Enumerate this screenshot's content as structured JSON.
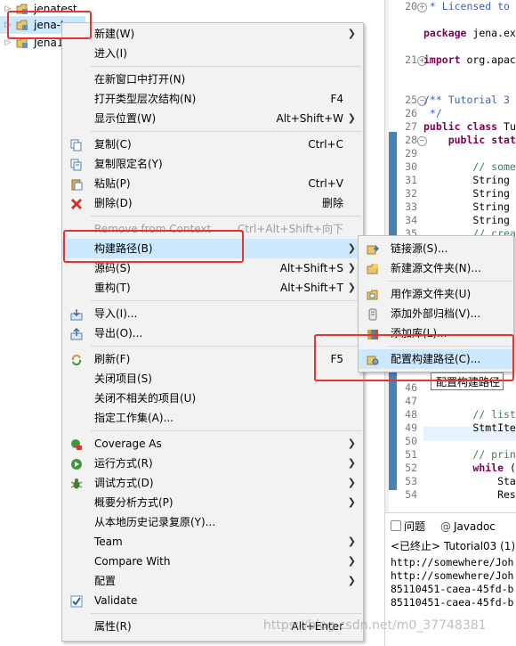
{
  "tree": {
    "items": [
      {
        "label": "jenatest",
        "expanded": false
      },
      {
        "label": "jena-t",
        "expanded": false,
        "selected": true
      },
      {
        "label": "Jena1",
        "expanded": false
      }
    ]
  },
  "context_menu": {
    "items": [
      {
        "label": "新建(W)",
        "submenu": true,
        "icon": "none"
      },
      {
        "label": "进入(I)",
        "icon": "none"
      },
      {
        "separator": true
      },
      {
        "label": "在新窗口中打开(N)",
        "icon": "none"
      },
      {
        "label": "打开类型层次结构(N)",
        "shortcut": "F4",
        "icon": "none"
      },
      {
        "label": "显示位置(W)",
        "shortcut": "Alt+Shift+W",
        "submenu": true,
        "icon": "none"
      },
      {
        "separator": true
      },
      {
        "label": "复制(C)",
        "shortcut": "Ctrl+C",
        "icon": "copy-icon"
      },
      {
        "label": "复制限定名(Y)",
        "icon": "copy-qualified-icon"
      },
      {
        "label": "粘贴(P)",
        "shortcut": "Ctrl+V",
        "icon": "paste-icon"
      },
      {
        "label": "删除(D)",
        "shortcut": "删除",
        "icon": "delete-icon"
      },
      {
        "separator": true
      },
      {
        "label": "Remove from Context",
        "shortcut": "Ctrl+Alt+Shift+向下",
        "disabled": true,
        "icon": "none"
      },
      {
        "label": "构建路径(B)",
        "submenu": true,
        "highlighted": true,
        "icon": "none"
      },
      {
        "label": "源码(S)",
        "shortcut": "Alt+Shift+S",
        "submenu": true,
        "icon": "none"
      },
      {
        "label": "重构(T)",
        "shortcut": "Alt+Shift+T",
        "submenu": true,
        "icon": "none"
      },
      {
        "separator": true
      },
      {
        "label": "导入(I)...",
        "icon": "import-icon"
      },
      {
        "label": "导出(O)...",
        "icon": "export-icon"
      },
      {
        "separator": true
      },
      {
        "label": "刷新(F)",
        "shortcut": "F5",
        "icon": "refresh-icon"
      },
      {
        "label": "关闭项目(S)",
        "icon": "none"
      },
      {
        "label": "关闭不相关的项目(U)",
        "icon": "none"
      },
      {
        "label": "指定工作集(A)...",
        "icon": "none"
      },
      {
        "separator": true
      },
      {
        "label": "Coverage As",
        "submenu": true,
        "icon": "coverage-icon"
      },
      {
        "label": "运行方式(R)",
        "submenu": true,
        "icon": "run-icon"
      },
      {
        "label": "调试方式(D)",
        "submenu": true,
        "icon": "debug-icon"
      },
      {
        "label": "概要分析方式(P)",
        "submenu": true,
        "icon": "none"
      },
      {
        "label": "从本地历史记录复原(Y)...",
        "icon": "none"
      },
      {
        "label": "Team",
        "submenu": true,
        "icon": "none"
      },
      {
        "label": "Compare With",
        "submenu": true,
        "icon": "none"
      },
      {
        "label": "配置",
        "submenu": true,
        "icon": "none"
      },
      {
        "label": "Validate",
        "icon": "check-icon"
      },
      {
        "separator": true
      },
      {
        "label": "属性(R)",
        "shortcut": "Alt+Enter",
        "icon": "none"
      }
    ]
  },
  "submenu": {
    "items": [
      {
        "label": "链接源(S)...",
        "icon": "link-source-icon"
      },
      {
        "label": "新建源文件夹(N)...",
        "icon": "new-source-folder-icon"
      },
      {
        "separator": true
      },
      {
        "label": "用作源文件夹(U)",
        "icon": "use-source-folder-icon"
      },
      {
        "label": "添加外部归档(V)...",
        "icon": "add-archive-icon"
      },
      {
        "label": "添加库(L)...",
        "icon": "add-library-icon"
      },
      {
        "separator": true
      },
      {
        "label": "配置构建路径(C)...",
        "icon": "configure-build-path-icon",
        "highlighted": true
      }
    ]
  },
  "tooltip": "配置构建路径",
  "editor": {
    "lines": [
      {
        "n": "20",
        "fold": "plus",
        "html": "<span class='jd'> * Licensed to</span>"
      },
      {
        "n": "",
        "html": ""
      },
      {
        "n": "",
        "html": "<span class='kw'>package</span> jena.ex"
      },
      {
        "n": "",
        "html": ""
      },
      {
        "n": "21",
        "fold": "plus",
        "html": "<span class='kw'>import</span> org.apac"
      },
      {
        "n": "",
        "html": ""
      },
      {
        "n": "",
        "html": ""
      },
      {
        "n": "25",
        "fold": "minus",
        "html": "<span class='jd'>/** Tutorial 3</span>"
      },
      {
        "n": "26",
        "html": "<span class='jd'> */</span>"
      },
      {
        "n": "27",
        "html": "<span class='kw'>public</span> <span class='kw'>class</span> Tu"
      },
      {
        "n": "28",
        "fold": "minus",
        "html": "    <span class='kw'>public</span> <span class='kw'>stat</span>"
      },
      {
        "n": "29",
        "html": ""
      },
      {
        "n": "30",
        "html": "        <span class='cm'>// some</span>"
      },
      {
        "n": "31",
        "html": "        String"
      },
      {
        "n": "32",
        "html": "        String"
      },
      {
        "n": "33",
        "html": "        String"
      },
      {
        "n": "34",
        "html": "        String"
      },
      {
        "n": "35",
        "html": "        <span class='cm'>// crea</span>"
      },
      {
        "n": "",
        "html": ""
      },
      {
        "n": "",
        "html": ""
      },
      {
        "n": "",
        "html": ""
      },
      {
        "n": "",
        "html": ""
      },
      {
        "n": "",
        "html": ""
      },
      {
        "n": "",
        "html": ""
      },
      {
        "n": "",
        "html": ""
      },
      {
        "n": "",
        "html": ""
      },
      {
        "n": "",
        "html": ""
      },
      {
        "n": "",
        "html": ""
      },
      {
        "n": "46",
        "html": ""
      },
      {
        "n": "47",
        "html": ""
      },
      {
        "n": "48",
        "html": "        <span class='cm'>// list</span>"
      },
      {
        "n": "49",
        "html": "        StmtIte"
      },
      {
        "n": "50",
        "html": ""
      },
      {
        "n": "51",
        "html": "        <span class='cm'>// prin</span>"
      },
      {
        "n": "52",
        "html": "        <span class='kw'>while</span> ("
      },
      {
        "n": "53",
        "html": "            Sta"
      },
      {
        "n": "54",
        "html": "            Res"
      }
    ]
  },
  "console": {
    "tab_problems": "问题",
    "tab_javadoc": "Javadoc",
    "status": "<已终止> Tutorial03 (1)",
    "lines": [
      "http://somewhere/Joh",
      "http://somewhere/Joh",
      "85110451-caea-45fd-b",
      "85110451-caea-45fd-b"
    ]
  },
  "watermark": "https://blog.csdn.net/m0_37748381",
  "colors": {
    "highlight": "#cce8ff",
    "annotation_box": "#e8332f"
  }
}
